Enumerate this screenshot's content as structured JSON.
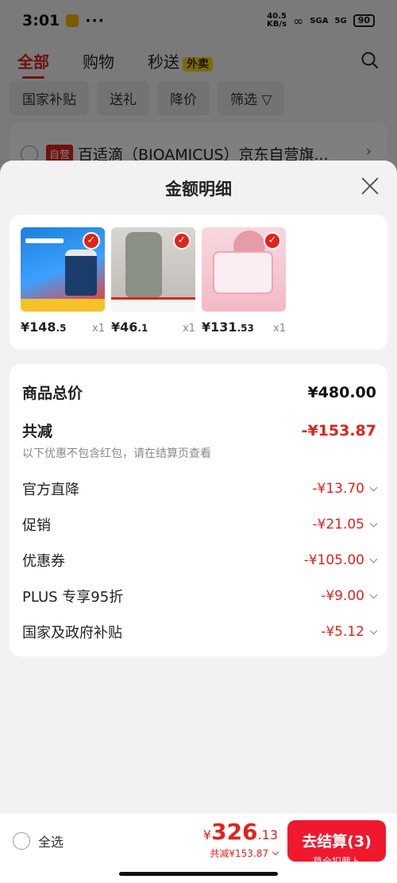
{
  "status": {
    "time": "3:01",
    "dots": "···",
    "speed_top": "40.5",
    "speed_bottom": "KB/s",
    "signal1": "SGA",
    "signal2": "5G",
    "battery": "90"
  },
  "tabs": [
    {
      "label": "全部"
    },
    {
      "label": "购物"
    },
    {
      "label": "秒送"
    }
  ],
  "waimai_badge": "外卖",
  "chips": [
    {
      "label": "国家补贴"
    },
    {
      "label": "送礼"
    },
    {
      "label": "降价"
    },
    {
      "label": "筛选"
    }
  ],
  "store": {
    "tag": "自营",
    "name": "百适滴（BIOAMICUS）京东自营旗..."
  },
  "sheet": {
    "title": "金额明细"
  },
  "products": [
    {
      "price_int": "¥148",
      "price_dec": ".5",
      "qty": "x1"
    },
    {
      "price_int": "¥46",
      "price_dec": ".1",
      "qty": "x1"
    },
    {
      "price_int": "¥131",
      "price_dec": ".53",
      "qty": "x1"
    }
  ],
  "detail": {
    "total_label": "商品总价",
    "total_value": "¥480.00",
    "reduce_label": "共减",
    "reduce_value": "-¥153.87",
    "note": "以下优惠不包含红包，请在结算页查看",
    "items": [
      {
        "label": "官方直降",
        "value": "-¥13.70"
      },
      {
        "label": "促销",
        "value": "-¥21.05"
      },
      {
        "label": "优惠券",
        "value": "-¥105.00"
      },
      {
        "label": "PLUS 专享95折",
        "value": "-¥9.00"
      },
      {
        "label": "国家及政府补贴",
        "value": "-¥5.12"
      }
    ]
  },
  "bottom": {
    "select_all": "全选",
    "currency": "¥",
    "amount_int": "326",
    "amount_dec": ".13",
    "reduced": "共减¥153.87",
    "checkout": "去结算(3)",
    "checkout_sub": "莫全扣萝卜"
  },
  "colors": {
    "accent": "#e2231a",
    "checkout_bg": "#f0182d",
    "waimai": "#ffd500"
  }
}
